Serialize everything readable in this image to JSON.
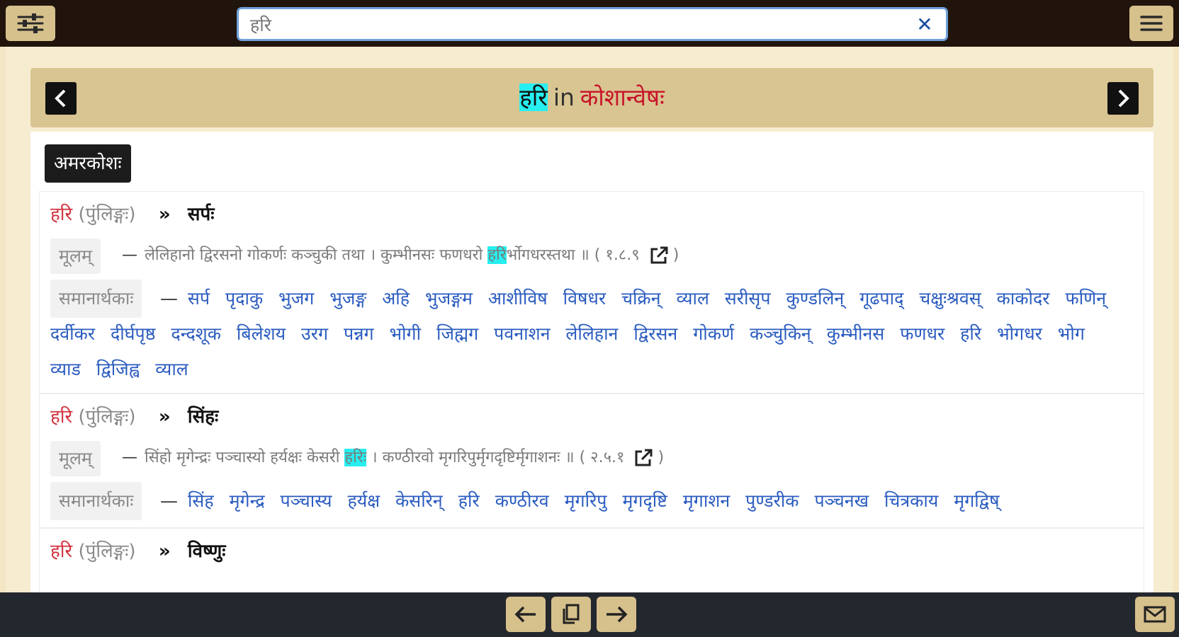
{
  "search": {
    "value": "हरि"
  },
  "title": {
    "term": "हरि",
    "in": "in",
    "source": "कोशान्वेषः"
  },
  "badge": "अमरकोशः",
  "entries": [
    {
      "word": "हरि",
      "gender": "(पुंलिङ्गः)",
      "arrows": "»",
      "meaning": "सर्पः",
      "mulam_label": "मूलम्",
      "verse_pre": "लेलिहानो द्विरसनो गोकर्णः कञ्चुकी तथा । कुम्भीनसः फणधरो ",
      "verse_hl": "हरि",
      "verse_post": "र्भोगधरस्तथा ॥ ( १.८.९",
      "verse_close": ")",
      "syn_label": "समानार्थकाः",
      "synonyms": [
        "सर्प",
        "पृदाकु",
        "भुजग",
        "भुजङ्ग",
        "अहि",
        "भुजङ्गम",
        "आशीविष",
        "विषधर",
        "चक्रिन्",
        "व्याल",
        "सरीसृप",
        "कुण्डलिन्",
        "गूढपाद्",
        "चक्षुःश्रवस्",
        "काकोदर",
        "फणिन्",
        "दर्वीकर",
        "दीर्घपृष्ठ",
        "दन्दशूक",
        "बिलेशय",
        "उरग",
        "पन्नग",
        "भोगी",
        "जिह्मग",
        "पवनाशन",
        "लेलिहान",
        "द्विरसन",
        "गोकर्ण",
        "कञ्चुकिन्",
        "कुम्भीनस",
        "फणधर",
        "हरि",
        "भोगधर",
        "भोग",
        "व्याड",
        "द्विजिह्व",
        "व्याल"
      ]
    },
    {
      "word": "हरि",
      "gender": "(पुंलिङ्गः)",
      "arrows": "»",
      "meaning": "सिंहः",
      "mulam_label": "मूलम्",
      "verse_pre": "सिंहो मृगेन्द्रः पञ्चास्यो हर्यक्षः केसरी ",
      "verse_hl": "हरिः",
      "verse_post": " । कण्ठीरवो मृगरिपुर्मृगदृष्टिर्मृगाशनः ॥ ( २.५.१",
      "verse_close": ")",
      "syn_label": "समानार्थकाः",
      "synonyms": [
        "सिंह",
        "मृगेन्द्र",
        "पञ्चास्य",
        "हर्यक्ष",
        "केसरिन्",
        "हरि",
        "कण्ठीरव",
        "मृगरिपु",
        "मृगदृष्टि",
        "मृगाशन",
        "पुण्डरीक",
        "पञ्चनख",
        "चित्रकाय",
        "मृगद्विष्"
      ]
    },
    {
      "word": "हरि",
      "gender": "(पुंलिङ्गः)",
      "arrows": "»",
      "meaning": "विष्णुः"
    }
  ],
  "icons": {
    "settings": "sliders-icon",
    "menu": "hamburger-menu-icon",
    "clear": "close-icon",
    "prev": "chevron-left-icon",
    "next": "chevron-right-icon",
    "external": "external-link-icon",
    "back": "arrow-left-icon",
    "copy": "copy-icon",
    "forward": "arrow-right-icon",
    "mail": "mail-icon"
  },
  "colors": {
    "topbar": "#20140c",
    "button": "#d6c08c",
    "title_bar": "#d9c592",
    "highlight": "#27eef0",
    "source_red": "#c8142a",
    "synonym_blue": "#2b5cc0",
    "bottombar": "#23272e"
  }
}
